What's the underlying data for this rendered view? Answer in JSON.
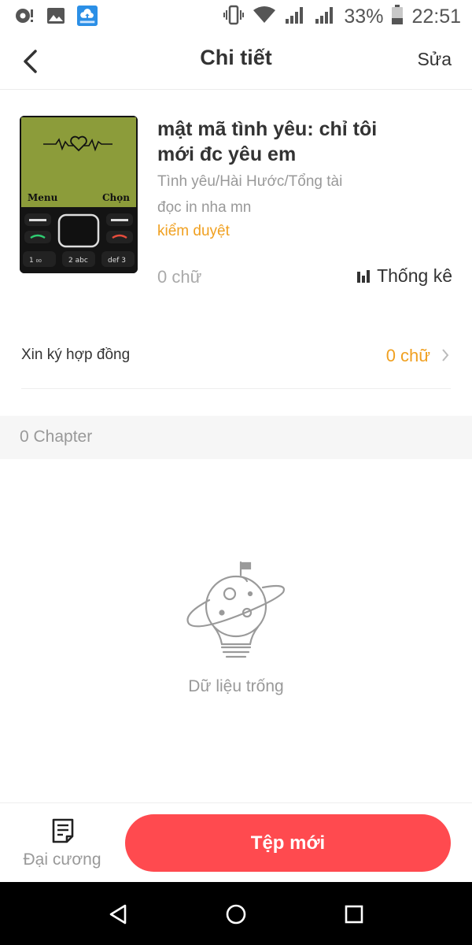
{
  "status_bar": {
    "battery": "33%",
    "time": "22:51",
    "icons": [
      "notification-dot-icon",
      "gallery-icon",
      "cloud-upload-icon",
      "vibrate-icon",
      "wifi-icon",
      "signal-icon",
      "signal-icon",
      "battery-icon"
    ]
  },
  "header": {
    "title": "Chi tiết",
    "edit_label": "Sửa",
    "back_icon": "chevron-left-icon"
  },
  "book": {
    "title": "mật mã tình yêu: chỉ tôi mới đc yêu em",
    "genre": "Tình yêu/Hài Hước/Tổng tài",
    "description": "đọc in nha mn",
    "status": "kiểm duyệt",
    "word_count": "0 chữ",
    "stats_label": "Thống kê",
    "cover": {
      "left_softkey": "Menu",
      "right_softkey": "Chọn",
      "key1": "1 ₀₀",
      "key2": "2 abc",
      "key3": "def 3"
    }
  },
  "contract": {
    "label": "Xin ký hợp đồng",
    "value": "0 chữ"
  },
  "chapters": {
    "count_label": "0 Chapter"
  },
  "empty_state": {
    "text": "Dữ liệu trống",
    "icon": "planet-lightbulb-icon"
  },
  "bottom": {
    "outline_label": "Đại cương",
    "new_button_label": "Tệp mới"
  },
  "colors": {
    "accent": "#ff4a4f",
    "warning": "#f0a020",
    "muted_text": "#999999"
  }
}
